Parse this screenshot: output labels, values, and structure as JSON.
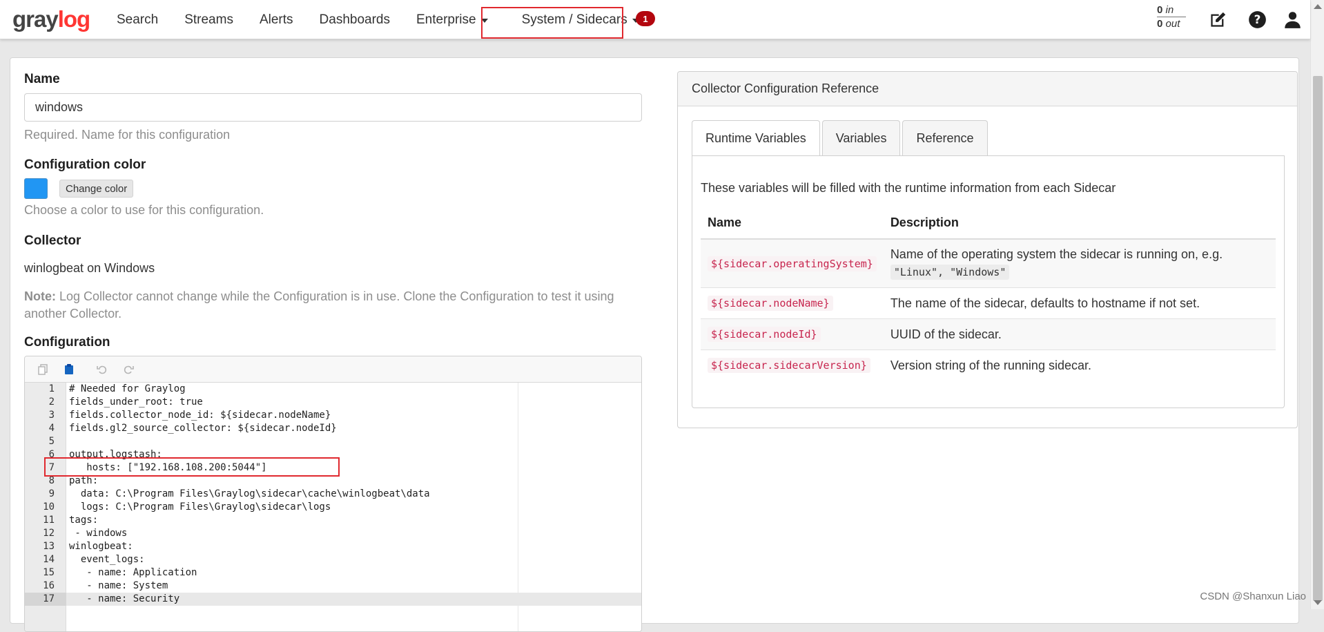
{
  "navbar": {
    "logo_part1": "gray",
    "logo_part2": "log",
    "items": [
      "Search",
      "Streams",
      "Alerts",
      "Dashboards",
      "Enterprise",
      "System / Sidecars"
    ],
    "notification_count": "1",
    "throughput": {
      "in_count": "0",
      "in_label": "in",
      "out_count": "0",
      "out_label": "out"
    },
    "icons": [
      "edit-icon",
      "help-icon",
      "user-icon"
    ]
  },
  "form": {
    "name_label": "Name",
    "name_value": "windows",
    "name_help": "Required. Name for this configuration",
    "color_label": "Configuration color",
    "color_value": "#2196f3",
    "change_color_label": "Change color",
    "color_help": "Choose a color to use for this configuration.",
    "collector_label": "Collector",
    "collector_value": "winlogbeat on Windows",
    "note_label": "Note:",
    "note_text": "Log Collector cannot change while the Configuration is in use. Clone the Configuration to test it using another Collector.",
    "configuration_label": "Configuration"
  },
  "editor": {
    "toolbar": [
      "copy-icon",
      "paste-icon",
      "undo-icon",
      "redo-icon"
    ],
    "active_line": 17,
    "lines": [
      "# Needed for Graylog",
      "fields_under_root: true",
      "fields.collector_node_id: ${sidecar.nodeName}",
      "fields.gl2_source_collector: ${sidecar.nodeId}",
      "",
      "output.logstash:",
      "   hosts: [\"192.168.108.200:5044\"]",
      "path:",
      "  data: C:\\Program Files\\Graylog\\sidecar\\cache\\winlogbeat\\data",
      "  logs: C:\\Program Files\\Graylog\\sidecar\\logs",
      "tags:",
      " - windows",
      "winlogbeat:",
      "  event_logs:",
      "   - name: Application",
      "   - name: System",
      "   - name: Security"
    ]
  },
  "reference": {
    "title": "Collector Configuration Reference",
    "tabs": [
      "Runtime Variables",
      "Variables",
      "Reference"
    ],
    "active_tab": "Runtime Variables",
    "intro": "These variables will be filled with the runtime information from each Sidecar",
    "columns": [
      "Name",
      "Description"
    ],
    "rows": [
      {
        "name": "${sidecar.operatingSystem}",
        "description": "Name of the operating system the sidecar is running on, e.g.",
        "example": "\"Linux\", \"Windows\""
      },
      {
        "name": "${sidecar.nodeName}",
        "description": "The name of the sidecar, defaults to hostname if not set."
      },
      {
        "name": "${sidecar.nodeId}",
        "description": "UUID of the sidecar."
      },
      {
        "name": "${sidecar.sidecarVersion}",
        "description": "Version string of the running sidecar."
      }
    ]
  },
  "watermark": "CSDN @Shanxun Liao"
}
